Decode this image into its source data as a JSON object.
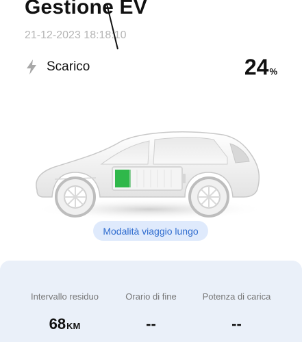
{
  "header": {
    "title": "Gestione EV",
    "timestamp": "21-12-2023 18:18:10"
  },
  "status": {
    "icon": "lightning-icon",
    "label": "Scarico",
    "battery_percent": "24",
    "battery_unit": "%"
  },
  "vehicle": {
    "battery_level": 0.24,
    "battery_color": "#2fb84a"
  },
  "mode": {
    "label": "Modalità viaggio lungo"
  },
  "stats": [
    {
      "label": "Intervallo residuo",
      "value": "68",
      "unit": "KM"
    },
    {
      "label": "Orario di fine",
      "value": "--",
      "unit": ""
    },
    {
      "label": "Potenza di carica",
      "value": "--",
      "unit": ""
    }
  ],
  "colors": {
    "accent": "#2f6ccf",
    "pill_bg": "#dfeafc",
    "panel_bg": "#eaf0f9"
  }
}
